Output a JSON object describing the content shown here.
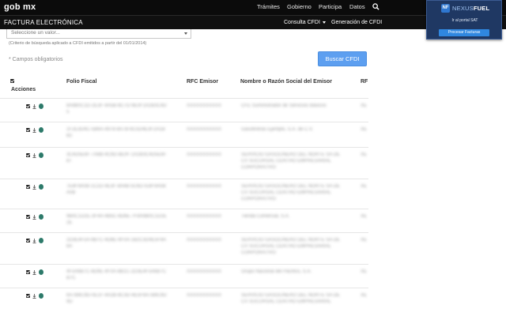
{
  "gob_bar": {
    "logo": "gob mx",
    "nav": [
      "Trámites",
      "Gobierno",
      "Participa",
      "Datos"
    ],
    "search_icon": "search-icon"
  },
  "sat_bar": {
    "title": "FACTURA ELECTRÓNICA",
    "menu": [
      "Consulta CFDI",
      "Generación de CFDI"
    ]
  },
  "popup": {
    "logo_mark": "NF",
    "logo_prefix": "NEXUS",
    "logo_suffix": "FUEL",
    "link": "Ir al portal SAT",
    "button": "Procesar Facturas"
  },
  "form": {
    "select_value": "Seleccione un valor...",
    "hint": "(Criterio de búsqueda aplicado a CFDI emitidos a partir del 01/01/2014)",
    "required": "* Campos obligatorios",
    "search_button": "Buscar CFDI"
  },
  "table": {
    "headers": {
      "acciones": "Acciones",
      "folio": "Folio Fiscal",
      "rfc": "RFC Emisor",
      "nombre": "Nombre o Razón Social del Emisor",
      "rf_partial": "RF"
    },
    "rows": [
      {
        "folio": [
          "8A9B0C1D-2E3F-4A5B-8C7D-9E0F1A2B3C4D",
          "5"
        ],
        "rfc": [
          "XXXXXXXXXXX"
        ],
        "nombre": [
          "CFE Suministrador de Servicios Básicos"
        ],
        "rf": "XE"
      },
      {
        "folio": [
          "1F2E3D4C-5B6A-4978-8A7B-6C5D4E3F2A1B",
          "B2"
        ],
        "rfc": [
          "XXXXXXXXXXX"
        ],
        "nombre": [
          "Gasolineras Ejemplo, S.A. de C.V."
        ],
        "rf": "XE"
      },
      {
        "folio": [
          "3C4D5E6F-7A8B-4C9D-8E0F-1A2B3C4D5E6F",
          "87"
        ],
        "rfc": [
          "XXXXXXXXXXX"
        ],
        "nombre": [
          "SERVICIO GASOLINERO DEL NORTE SA DE",
          "CV SUCURSAL CENTRO EMPRESARIAL",
          "CORPORATIVO"
        ],
        "rf": "XE"
      },
      {
        "folio": [
          "7E8F9A0B-1C2D-4E3F-8A4B-5C6D7E8F9A0B",
          "A0B"
        ],
        "rfc": [
          "XXXXXXXXXXX"
        ],
        "nombre": [
          "SERVICIO GASOLINERO DEL NORTE SA DE",
          "CV SUCURSAL CENTRO EMPRESARIAL",
          "CORPORATIVO"
        ],
        "rf": "XE"
      },
      {
        "folio": [
          "9B0C1D2E-3F4A-4B5C-8D6E-7F8A9B0C1D2E",
          "2E"
        ],
        "rfc": [
          "XXXXXXXXXXX"
        ],
        "nombre": [
          "Tienda Comercial, S.A."
        ],
        "rf": "XE"
      },
      {
        "folio": [
          "2D3E4F5A-6B7C-4D8E-9F0A-1B2C3D4E5F6A",
          "6A"
        ],
        "rfc": [
          "XXXXXXXXXXX"
        ],
        "nombre": [
          "SERVICIO GASOLINERO DEL NORTE SA DE",
          "CV SUCURSAL CENTRO EMPRESARIAL",
          "CORPORATIVO"
        ],
        "rf": "XE"
      },
      {
        "folio": [
          "4F5A6B7C-8D9E-4F0A-8B1C-2D3E4F5A6B7C",
          "B7C"
        ],
        "rfc": [
          "XXXXXXXXXXX"
        ],
        "nombre": [
          "Grupo Nacional del Pacífico, S.A."
        ],
        "rf": "XE"
      },
      {
        "folio": [
          "6A7B8C9D-0E1F-4A2B-8C3D-4E5F6A7B8C9D",
          "9D"
        ],
        "rfc": [
          "XXXXXXXXXXX"
        ],
        "nombre": [
          "SERVICIO GASOLINERO DEL NORTE SA DE",
          "CV SUCURSAL CENTRO EMPRESARIAL"
        ],
        "rf": "XE"
      }
    ]
  },
  "colors": {
    "topbar": "#0b0b0b",
    "button": "#5d9ff0",
    "popup_bg": "#1f3863",
    "popup_button": "#2f87e0"
  }
}
